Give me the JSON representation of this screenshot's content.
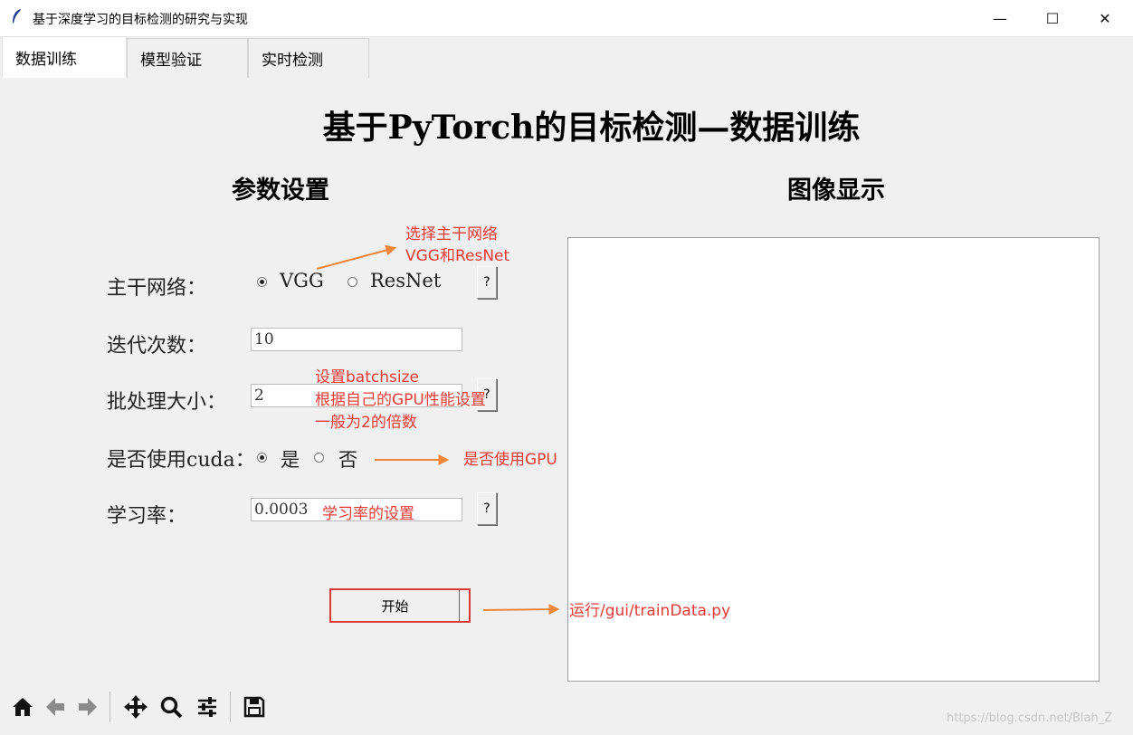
{
  "window": {
    "title": "基于深度学习的目标检测的研究与实现",
    "minimize_icon": "minimize-icon",
    "maximize_icon": "maximize-icon",
    "close_icon": "close-icon",
    "minimize_glyph": "—",
    "maximize_glyph": "☐",
    "close_glyph": "✕"
  },
  "tabs": [
    {
      "label": "数据训练",
      "active": true
    },
    {
      "label": "模型验证",
      "active": false
    },
    {
      "label": "实时检测",
      "active": false
    }
  ],
  "main": {
    "title": "基于PyTorch的目标检测—数据训练",
    "params_heading": "参数设置",
    "image_heading": "图像显示"
  },
  "params": {
    "backbone_label": "主干网络：",
    "backbone_options": [
      "VGG",
      "ResNet"
    ],
    "backbone_selected": "VGG",
    "epochs_label": "迭代次数：",
    "epochs_value": "10",
    "batch_label": "批处理大小：",
    "batch_value": "2",
    "cuda_label": "是否使用cuda：",
    "cuda_options": [
      "是",
      "否"
    ],
    "cuda_selected": "是",
    "lr_label": "学习率：",
    "lr_value": "0.0003",
    "help_label": "?",
    "start_label": "开始"
  },
  "annotations": {
    "backbone": [
      "选择主干网络",
      "VGG和ResNet"
    ],
    "batch": [
      "设置batchsize",
      "根据自己的GPU性能设置",
      "一般为2的倍数"
    ],
    "cuda": "是否使用GPU",
    "lr": "学习率的设置",
    "start": "运行/gui/trainData.py",
    "color": "#e53935",
    "arrow_color": "#f0873a"
  },
  "toolbar": {
    "icons": [
      "home-icon",
      "back-arrow-icon",
      "forward-arrow-icon",
      "pan-icon",
      "zoom-icon",
      "configure-subplots-icon",
      "save-icon"
    ]
  },
  "watermark": "https://blog.csdn.net/Blah_Z"
}
